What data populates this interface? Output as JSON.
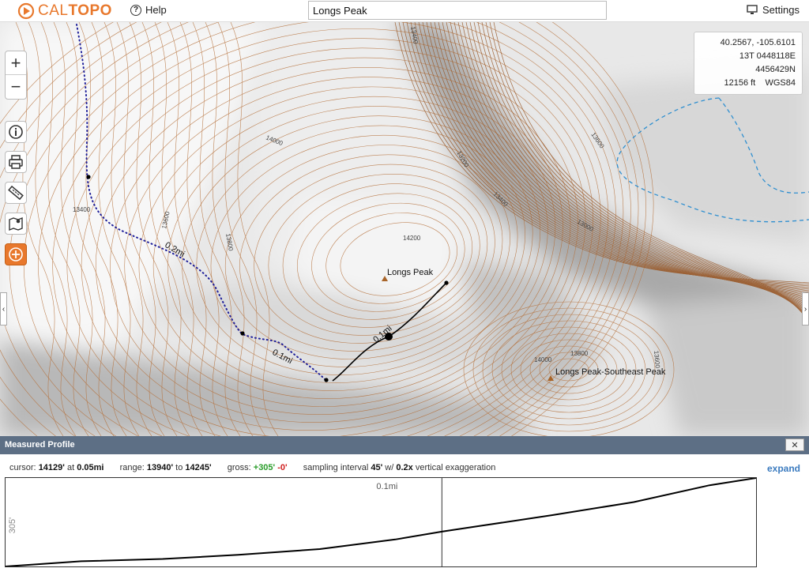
{
  "app": {
    "brand_cal": "CAL",
    "brand_topo": "TOPO"
  },
  "header": {
    "help_label": "Help",
    "search_value": "Longs Peak",
    "settings_label": "Settings"
  },
  "coords": {
    "latlon": "40.2567, -105.6101",
    "utm": "13T 0448118E 4456429N",
    "elev": "12156 ft",
    "datum": "WGS84"
  },
  "map": {
    "peaks": [
      {
        "name": "Longs Peak"
      },
      {
        "name": "Longs Peak-Southeast Peak"
      }
    ],
    "contour_labels": [
      "14000",
      "13400",
      "13600",
      "13800",
      "14200",
      "13200",
      "13400",
      "13600",
      "13400",
      "13000",
      "13800",
      "14000",
      "13600"
    ],
    "distance_labels": [
      "0.2mi",
      "0.1mi",
      "0.1mi"
    ],
    "colors": {
      "contour": "#b5703a",
      "route": "#1f1f9a",
      "measure": "#000000",
      "water": "#2f8fd0",
      "accent": "#e8782c"
    }
  },
  "profile": {
    "title": "Measured Profile",
    "close_label": "✕",
    "cursor_label": "cursor:",
    "cursor_value": "14129'",
    "at_label": "at",
    "at_value": "0.05mi",
    "range_label": "range:",
    "range_min": "13940'",
    "to_label": "to",
    "range_max": "14245'",
    "gross_label": "gross:",
    "gross_gain": "+305'",
    "gross_loss": "-0'",
    "sampling_label": "sampling interval",
    "sampling_value": "45'",
    "w_label": "w/",
    "exaggeration_value": "0.2x",
    "exaggeration_label": "vertical exaggeration",
    "expand_label": "expand"
  },
  "chart_data": {
    "type": "line",
    "x_unit": "mi",
    "y_unit": "ft",
    "xlim": [
      0,
      0.129
    ],
    "ylim": [
      13940,
      14245
    ],
    "cursor_x": 0.075,
    "cursor_label": "0.1mi",
    "y_axis_label": "305'",
    "series": [
      {
        "x": [
          0,
          0.013,
          0.027,
          0.04,
          0.054,
          0.067,
          0.075,
          0.081,
          0.094,
          0.108,
          0.121,
          0.129
        ],
        "y": [
          13940,
          13958,
          13966,
          13980,
          14000,
          14033,
          14060,
          14078,
          14117,
          14162,
          14220,
          14245
        ]
      }
    ]
  }
}
